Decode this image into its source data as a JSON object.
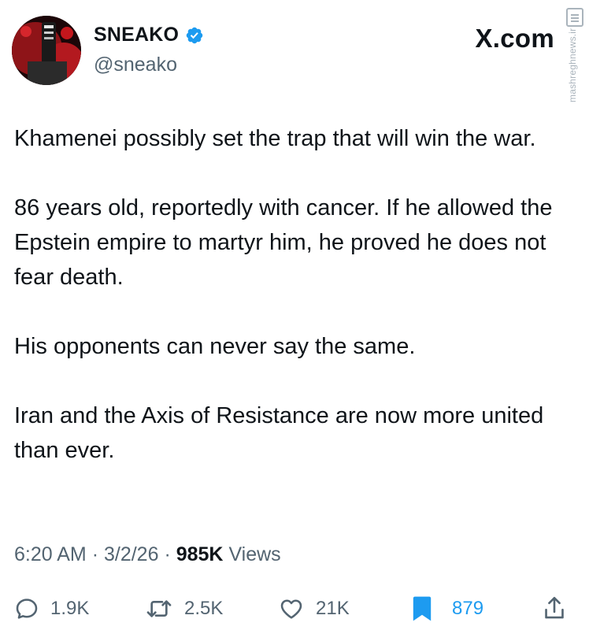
{
  "author": {
    "display_name": "SNEAKO",
    "handle": "@sneako",
    "verified": true,
    "avatar_icon": "avatar-icon"
  },
  "brand": {
    "wordmark": "X.com"
  },
  "watermark": {
    "text": "mashreghnews.ir",
    "logo_icon": "watermark-logo-icon"
  },
  "tweet": {
    "paragraphs": [
      "Khamenei possibly set the trap that will win the war.",
      "86 years old, reportedly with cancer. If he allowed the Epstein empire to martyr him, he proved he does not fear death.",
      "His opponents can never say the same.",
      "Iran and the Axis of Resistance are now more united than ever."
    ]
  },
  "meta": {
    "time": "6:20 AM",
    "separator": "·",
    "date": "3/2/26",
    "views_count": "985K",
    "views_label": "Views"
  },
  "actions": {
    "reply_count": "1.9K",
    "retweet_count": "2.5K",
    "like_count": "21K",
    "bookmark_count": "879"
  },
  "colors": {
    "text_primary": "#0f1419",
    "text_secondary": "#536471",
    "accent_blue": "#1d9bf0"
  }
}
